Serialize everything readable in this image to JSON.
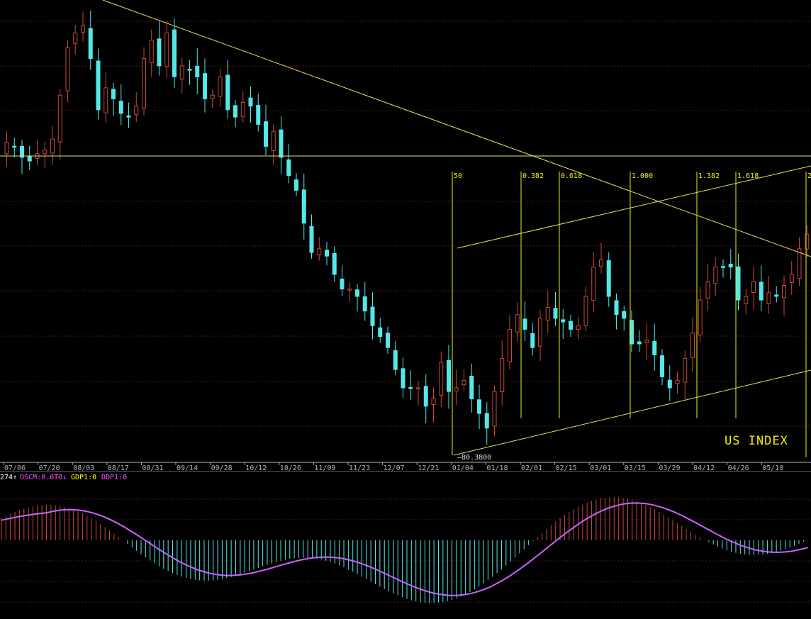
{
  "chart_data": {
    "type": "candlestick",
    "title": "US INDEX",
    "low_marker": "80.3800",
    "x_tick_labels": [
      "07/06",
      "07/20",
      "08/03",
      "08/17",
      "08/31",
      "09/14",
      "09/28",
      "10/12",
      "10/26",
      "11/09",
      "11/23",
      "12/07",
      "12/21",
      "01/04",
      "01/18",
      "02/01",
      "02/15",
      "03/01",
      "03/15",
      "03/29",
      "04/12",
      "04/26",
      "05/10"
    ],
    "fib_levels": [
      "50",
      "0.382",
      "0.618",
      "1.000",
      "1.382",
      "1.618",
      "2"
    ],
    "grid": "dotted horizontal",
    "price_series_approx_close": [
      88.3,
      88.2,
      87.9,
      87.8,
      88.0,
      88.1,
      88.4,
      89.6,
      90.9,
      91.3,
      91.5,
      90.6,
      89.2,
      89.8,
      89.5,
      89.1,
      89.0,
      89.3,
      90.6,
      91.1,
      90.4,
      91.3,
      90.1,
      90.4,
      90.3,
      90.1,
      89.5,
      89.6,
      90.1,
      89.2,
      89.0,
      89.4,
      89.3,
      88.8,
      88.2,
      88.6,
      87.9,
      87.4,
      87.0,
      86.1,
      85.3,
      85.4,
      85.2,
      84.7,
      84.3,
      84.3,
      84.1,
      83.7,
      83.3,
      83.0,
      82.7,
      82.1,
      81.6,
      81.6,
      81.6,
      81.1,
      81.3,
      82.3,
      81.5,
      81.6,
      81.8,
      81.3,
      80.9,
      80.5,
      81.5,
      82.4,
      83.2,
      83.6,
      83.2,
      82.7,
      83.5,
      83.8,
      83.5,
      83.4,
      83.2,
      83.3,
      84.1,
      84.9,
      85.1,
      84.1,
      83.6,
      83.5,
      82.8,
      82.8,
      82.9,
      82.5,
      81.9,
      81.6,
      81.8,
      82.4,
      83.1,
      84.0,
      84.5,
      84.9,
      84.9,
      84.9,
      84.0,
      84.1,
      84.5,
      84.0,
      84.2,
      84.1,
      84.4,
      84.7,
      85.4,
      85.8
    ]
  },
  "indicator": {
    "labels": [
      {
        "text": "274↑",
        "color": "#ffffff"
      },
      {
        "text": "OSCM:0.0TO↓",
        "color": "#ff55ff"
      },
      {
        "text": "GDP1:0",
        "color": "#ffff00"
      },
      {
        "text": "DDP1:0",
        "color": "#ff55ff"
      }
    ]
  },
  "colors": {
    "background": "#000000",
    "up_candle": "#c84a3c",
    "down_candle": "#54e8e8",
    "trend_line": "#e4e45a",
    "fib_line": "#f0f000",
    "grid": "#8a2222",
    "axis": "#b0b0b0",
    "osc_line": "#c864ff"
  }
}
